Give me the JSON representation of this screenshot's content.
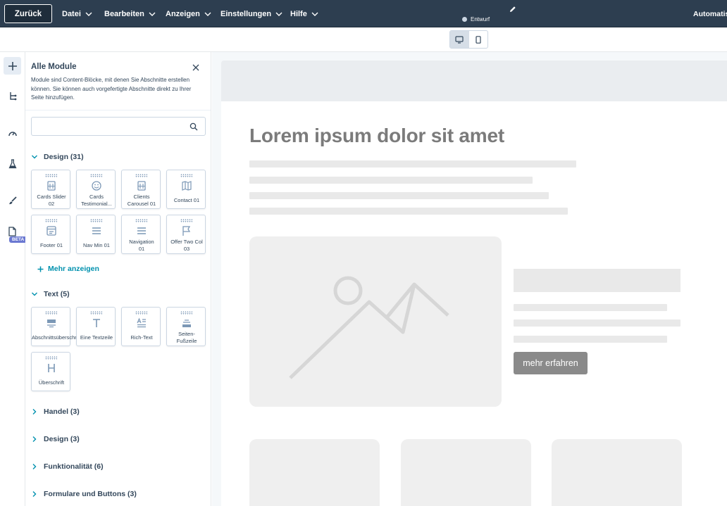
{
  "topbar": {
    "back_label": "Zurück",
    "menus": [
      "Datei",
      "Bearbeiten",
      "Anzeigen",
      "Einstellungen",
      "Hilfe"
    ],
    "status": "Entwurf",
    "right_label": "Automatis"
  },
  "sidebar_rail": {
    "beta_badge": "BETA",
    "icons": [
      "plus-icon",
      "tree-icon",
      "gauge-icon",
      "flask-icon",
      "brush-icon",
      "document-icon"
    ]
  },
  "panel": {
    "title": "Alle Module",
    "description": "Module sind Content-Blöcke, mit denen Sie Abschnitte erstellen können. Sie können auch vorgefertigte Abschnitte direkt zu Ihrer Seite hinzufügen.",
    "search_placeholder": "",
    "sections": {
      "design_open": "Design (31)",
      "text_open": "Text (5)",
      "handel": "Handel (3)",
      "design_closed": "Design (3)",
      "funktionalitaet": "Funktionalität (6)",
      "formulare": "Formulare und Buttons (3)"
    },
    "more_label": "Mehr anzeigen",
    "design_modules": [
      {
        "l1": "Cards Slider",
        "l2": "02",
        "icon": "building-icon"
      },
      {
        "l1": "Cards",
        "l2": "Testimonial...",
        "icon": "smiley-icon"
      },
      {
        "l1": "Clients",
        "l2": "Carousel 01",
        "icon": "building-icon"
      },
      {
        "l1": "Contact 01",
        "l2": "",
        "icon": "map-icon"
      },
      {
        "l1": "Footer 01",
        "l2": "",
        "icon": "window-icon"
      },
      {
        "l1": "Nav Min 01",
        "l2": "",
        "icon": "menu-icon"
      },
      {
        "l1": "Navigation",
        "l2": "01",
        "icon": "menu-icon"
      },
      {
        "l1": "Offer Two Col",
        "l2": "03",
        "icon": "flag-icon"
      }
    ],
    "text_modules": [
      {
        "l1": "Abschnittsüberschrift",
        "l2": "",
        "icon": "section-header-icon"
      },
      {
        "l1": "Eine Textzeile",
        "l2": "",
        "icon": "text-t-icon"
      },
      {
        "l1": "Rich-Text",
        "l2": "",
        "icon": "rich-text-icon"
      },
      {
        "l1": "Seiten-",
        "l2": "Fußzeile",
        "icon": "footer-icon"
      },
      {
        "l1": "Überschrift",
        "l2": "",
        "icon": "heading-h-icon"
      }
    ]
  },
  "preview": {
    "headline": "Lorem ipsum dolor sit amet",
    "cta_label": "mehr erfahren"
  },
  "colors": {
    "topbar": "#2d3e50",
    "accent_link": "#0091ae",
    "beta": "#6a78d1"
  }
}
